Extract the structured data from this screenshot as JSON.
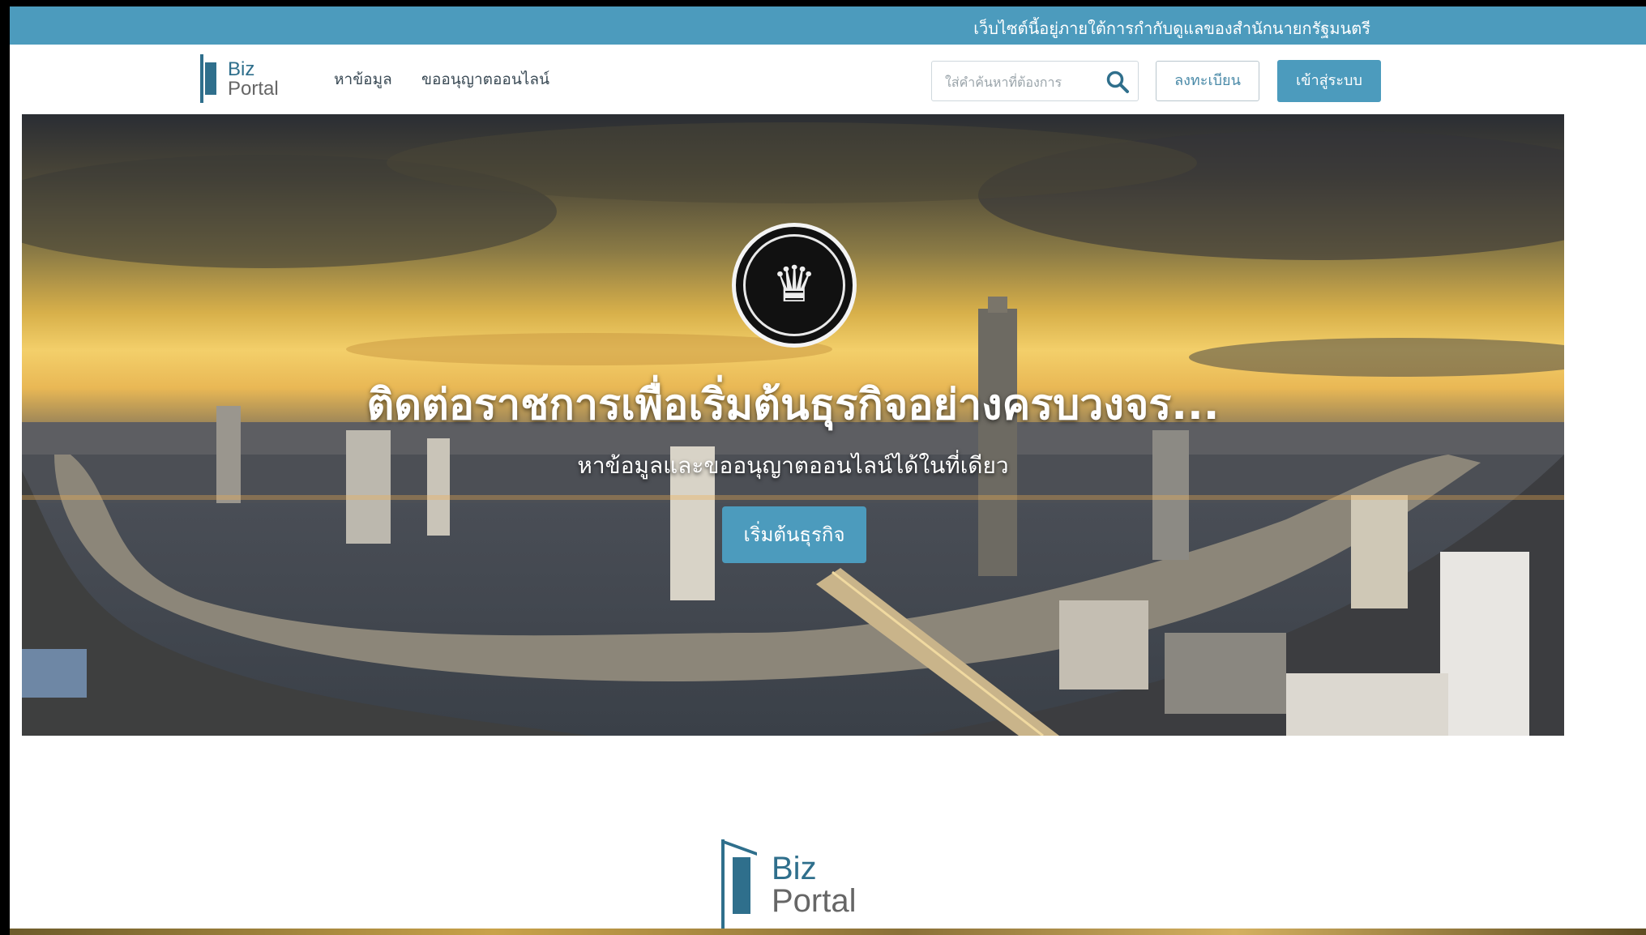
{
  "topbar": {
    "notice": "เว็บไซต์นี้อยู่ภายใต้การกำกับดูแลของสำนักนายกรัฐมนตรี"
  },
  "header": {
    "logo_line1": "Biz",
    "logo_line2": "Portal",
    "nav": [
      "หาข้อมูล",
      "ขออนุญาตออนไลน์"
    ],
    "search_placeholder": "ใส่คำค้นหาที่ต้องการ",
    "register_label": "ลงทะเบียน",
    "login_label": "เข้าสู่ระบบ"
  },
  "hero": {
    "title": "ติดต่อราชการเพื่อเริ่มต้นธุรกิจอย่างครบวงจร...",
    "subtitle": "หาข้อมูลและขออนุญาตออนไลน์ได้ในที่เดียว",
    "cta_label": "เริ่มต้นธุรกิจ"
  },
  "footer": {
    "logo_line1": "Biz",
    "logo_line2": "Portal"
  },
  "colors": {
    "brand": "#4c9bbd",
    "logo": "#2f6f8c"
  },
  "icons": [
    "search-icon",
    "government-seal-icon"
  ]
}
